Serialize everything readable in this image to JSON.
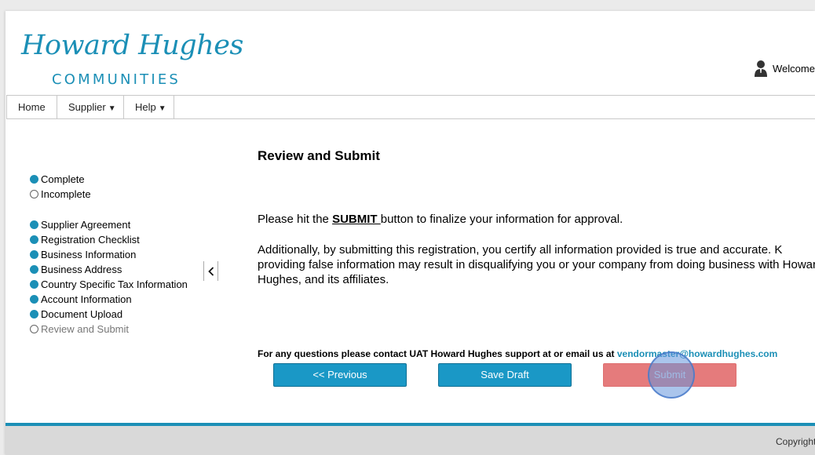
{
  "header": {
    "logo_script": "Howard Hughes",
    "logo_sub": "COMMUNITIES",
    "welcome": "Welcome"
  },
  "nav": {
    "items": [
      {
        "label": "Home"
      },
      {
        "label": "Supplier"
      },
      {
        "label": "Help"
      }
    ]
  },
  "legend": {
    "complete": "Complete",
    "incomplete": "Incomplete"
  },
  "steps": [
    {
      "label": "Supplier Agreement",
      "done": true
    },
    {
      "label": "Registration Checklist",
      "done": true
    },
    {
      "label": "Business Information",
      "done": true
    },
    {
      "label": "Business Address",
      "done": true
    },
    {
      "label": "Country Specific Tax Information",
      "done": true
    },
    {
      "label": "Account Information",
      "done": true
    },
    {
      "label": "Document Upload",
      "done": true
    },
    {
      "label": "Review and Submit",
      "done": false
    }
  ],
  "main": {
    "title": "Review and Submit",
    "para1_before": "Please hit the ",
    "para1_keyword": "SUBMIT ",
    "para1_after": "button to finalize your information for approval.",
    "para2": "Additionally, by submitting this registration, you certify all information provided is true and accurate. K providing false information may result in disqualifying you or your company from doing business with Howard Hughes, and its affiliates.",
    "contact_text": "For any questions please contact UAT Howard Hughes support at or email us at ",
    "contact_email": "vendormaster@howardhughes.com"
  },
  "buttons": {
    "previous": "<< Previous",
    "save_draft": "Save Draft",
    "submit": "Submit"
  },
  "footer": {
    "copyright": "Copyright"
  },
  "colors": {
    "brand": "#1b8fb6",
    "primary_button": "#1a98c6",
    "submit_button": "#e57b7c"
  }
}
